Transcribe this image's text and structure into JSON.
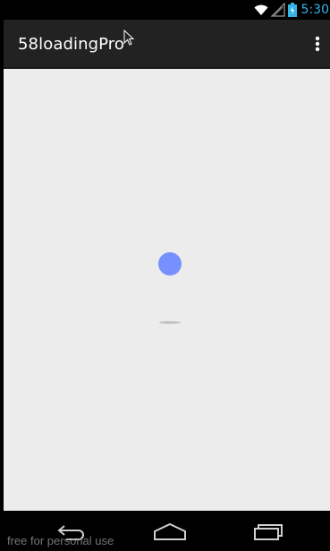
{
  "status_bar": {
    "time": "5:30",
    "time_color": "#33b5e5",
    "icons": [
      "wifi-icon",
      "signal-icon",
      "battery-icon"
    ]
  },
  "action_bar": {
    "title": "58loadingPro",
    "overflow_icon": "overflow-menu-icon",
    "background": "#222222"
  },
  "content": {
    "background": "#ececec",
    "loading_ball_color": "#7690ff",
    "loading_shadow_color": "#c2c2c2"
  },
  "nav_bar": {
    "buttons": [
      "back-icon",
      "home-icon",
      "recent-apps-icon"
    ]
  },
  "watermark": {
    "text": "free for personal use"
  }
}
